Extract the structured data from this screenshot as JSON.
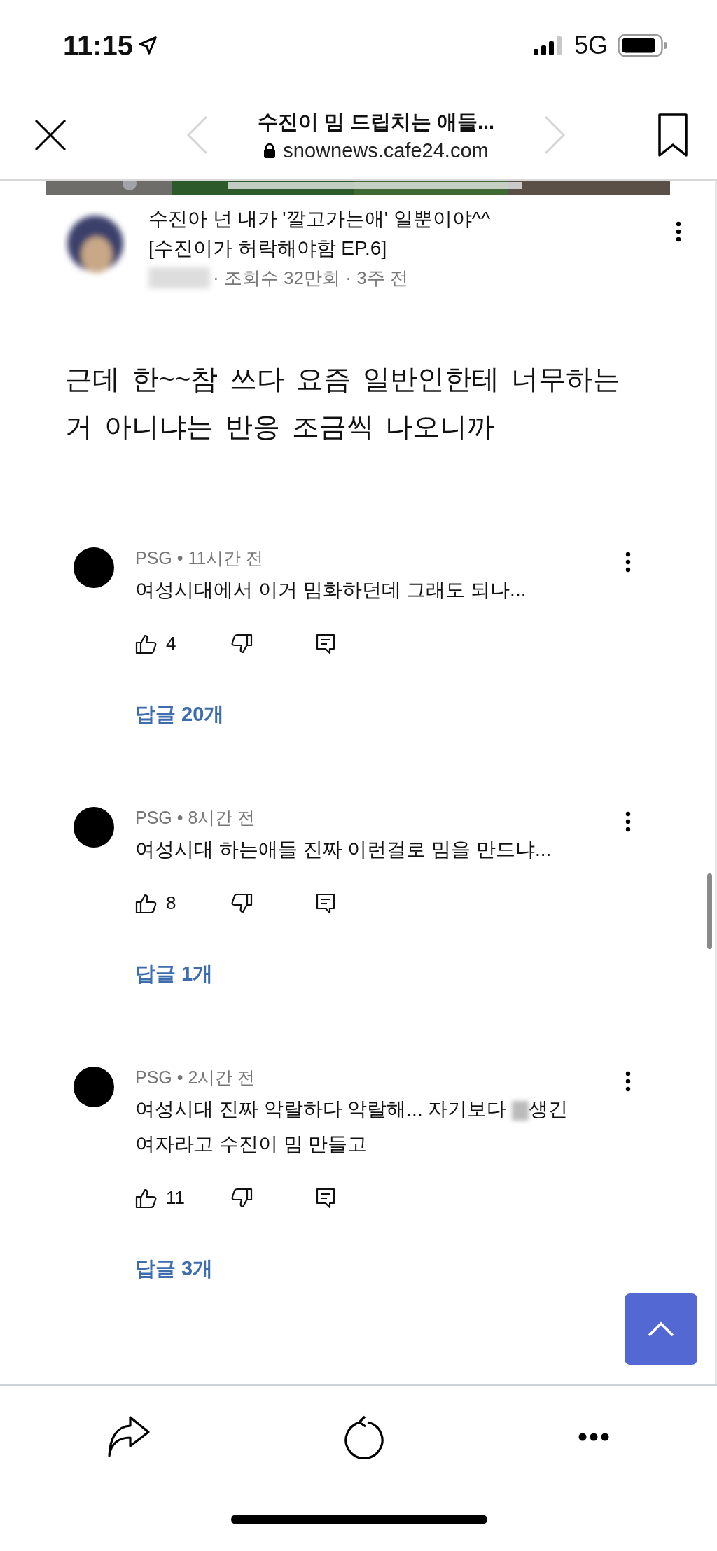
{
  "status_bar": {
    "time": "11:15",
    "network": "5G"
  },
  "nav": {
    "title": "수진이 밈 드립치는 애들...",
    "url": "snownews.cafe24.com"
  },
  "video": {
    "kind": "picture",
    "title_lines": [
      "수진아 넌 내가 '깔고가는애' 일뿐이야^^",
      "[수진이가 허락해야함 EP.6]"
    ],
    "meta": "· 조회수 32만회 · 3주 전"
  },
  "body": "근데 한~~참 쓰다 요즘 일반인한테 너무하는 거 아니냐는 반응 조금씩 나오니까",
  "comments": [
    {
      "meta": "PSG • 11시간 전",
      "text_parts": [
        "여성시대에서 이거 밈화하던데 그래도 되나..."
      ],
      "likes": "4",
      "replies": "답글 20개"
    },
    {
      "meta": "PSG • 8시간 전",
      "text_parts": [
        "여성시대 하는애들 진짜 이런걸로 밈을 만드냐..."
      ],
      "likes": "8",
      "replies": "답글 1개"
    },
    {
      "meta": "PSG • 2시간 전",
      "text_parts": [
        "여성시대 진짜 악랄하다 악랄해... 자기보다 ",
        "생긴 여자라고 수진이 밈 만들고"
      ],
      "likes": "11",
      "replies": "답글 3개"
    }
  ]
}
